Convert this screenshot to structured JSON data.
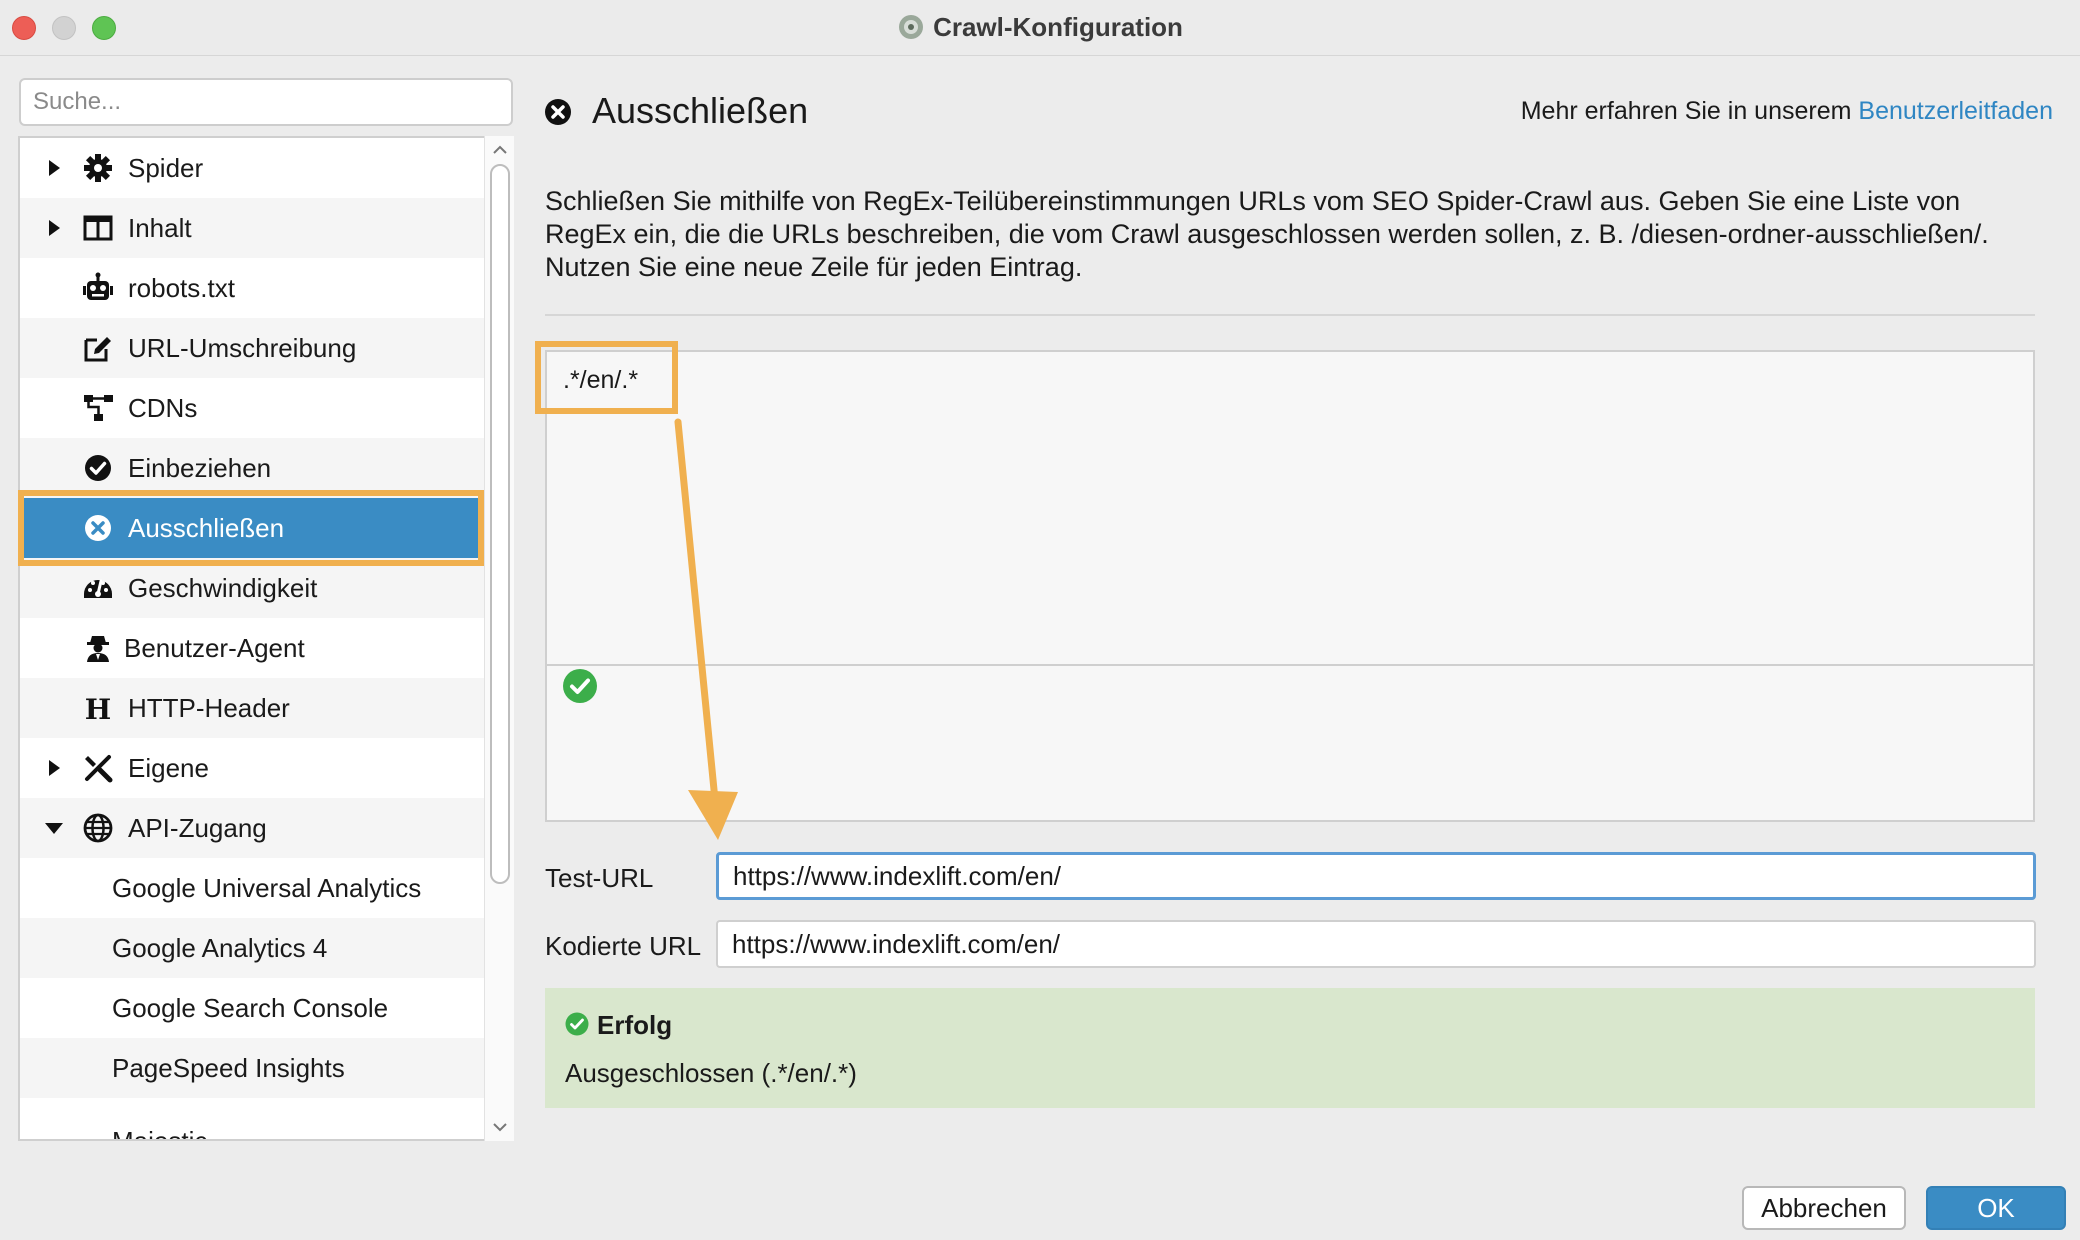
{
  "window": {
    "title": "Crawl-Konfiguration"
  },
  "sidebar": {
    "search_placeholder": "Suche...",
    "items": [
      {
        "label": "Spider",
        "icon": "gear-icon",
        "expandable": true,
        "expanded": false
      },
      {
        "label": "Inhalt",
        "icon": "columns-icon",
        "expandable": true,
        "expanded": false
      },
      {
        "label": "robots.txt",
        "icon": "robot-icon"
      },
      {
        "label": "URL-Umschreibung",
        "icon": "edit-icon"
      },
      {
        "label": "CDNs",
        "icon": "network-icon"
      },
      {
        "label": "Einbeziehen",
        "icon": "check-circle-icon"
      },
      {
        "label": "Ausschließen",
        "icon": "x-circle-icon",
        "selected": true
      },
      {
        "label": "Geschwindigkeit",
        "icon": "speedometer-icon"
      },
      {
        "label": "Benutzer-Agent",
        "icon": "user-secret-icon"
      },
      {
        "label": "HTTP-Header",
        "icon": "h-letter-icon"
      },
      {
        "label": "Eigene",
        "icon": "tools-icon",
        "expandable": true,
        "expanded": false
      },
      {
        "label": "API-Zugang",
        "icon": "globe-icon",
        "expandable": true,
        "expanded": true
      },
      {
        "label": "Google Universal Analytics",
        "sub": true
      },
      {
        "label": "Google Analytics 4",
        "sub": true
      },
      {
        "label": "Google Search Console",
        "sub": true
      },
      {
        "label": "PageSpeed Insights",
        "sub": true
      },
      {
        "label": "Majestic",
        "sub": true
      }
    ]
  },
  "main": {
    "title": "Ausschließen",
    "help_prefix": "Mehr erfahren Sie in unserem",
    "help_link": "Benutzerleitfaden",
    "description": "Schließen Sie mithilfe von RegEx-Teilübereinstimmungen URLs vom SEO Spider-Crawl aus. Geben Sie eine Liste von RegEx ein, die die URLs beschreiben, die vom Crawl ausgeschlossen werden sollen, z. B. /diesen-ordner-ausschließen/. Nutzen Sie eine neue Zeile für jeden Eintrag.",
    "regex_entries": [
      ".*/en/.*"
    ],
    "test_url_label": "Test-URL",
    "test_url_value": "https://www.indexlift.com/en/",
    "encoded_url_label": "Kodierte URL",
    "encoded_url_value": "https://www.indexlift.com/en/",
    "result_title": "Erfolg",
    "result_text": "Ausgeschlossen (.*/en/.*)"
  },
  "buttons": {
    "cancel": "Abbrechen",
    "ok": "OK"
  },
  "colors": {
    "accent": "#3a8cc4",
    "highlight": "#f0b04f",
    "success_bg": "#d9e7cd",
    "success_icon": "#3cae4a",
    "link": "#2f86c3"
  }
}
